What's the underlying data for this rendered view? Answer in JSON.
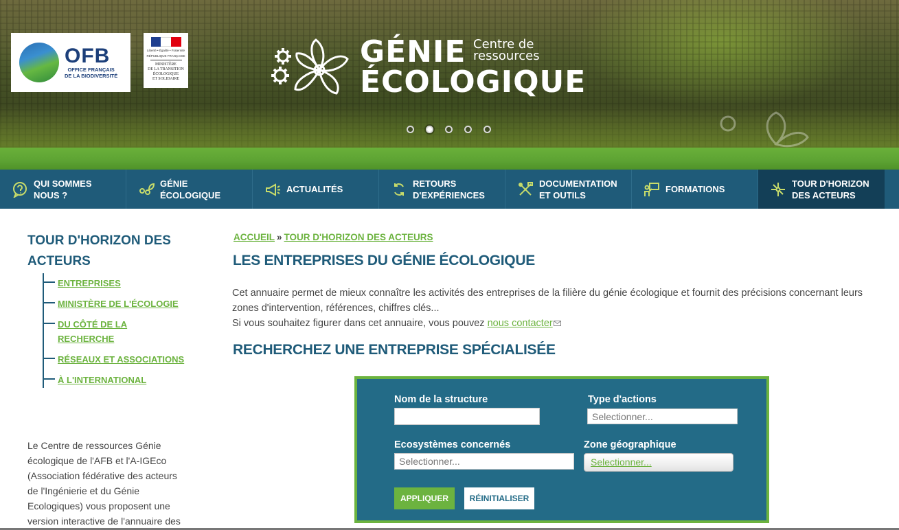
{
  "hero": {
    "title_main": "GÉNIE",
    "title_tag": "Centre de ressources",
    "title_second": "ÉCOLOGIQUE",
    "ofb_logo": {
      "acronym": "OFB",
      "subtitle_line1": "OFFICE FRANÇAIS",
      "subtitle_line2": "DE LA BIODIVERSITÉ"
    },
    "ministry_logo": {
      "motto": "Liberté • Égalité • Fraternité",
      "republic": "RÉPUBLIQUE FRANÇAISE",
      "name_line1": "MINISTÈRE",
      "name_line2": "DE LA TRANSITION",
      "name_line3": "ÉCOLOGIQUE",
      "name_line4": "ET SOLIDAIRE"
    },
    "carousel": {
      "slides": 5,
      "active_index": 1
    }
  },
  "nav": {
    "items": [
      {
        "label": "QUI SOMMES\nNOUS ?",
        "icon": "question-bubble-icon"
      },
      {
        "label": "GÉNIE\nÉCOLOGIQUE",
        "icon": "gears-leaf-icon"
      },
      {
        "label": "ACTUALITÉS",
        "icon": "megaphone-icon"
      },
      {
        "label": "RETOURS\nD'EXPÉRIENCES",
        "icon": "refresh-arrows-icon"
      },
      {
        "label": "DOCUMENTATION\nET OUTILS",
        "icon": "tools-icon"
      },
      {
        "label": "FORMATIONS",
        "icon": "presentation-icon"
      },
      {
        "label": "TOUR D'HORIZON\nDES ACTEURS",
        "icon": "network-icon"
      }
    ],
    "active_index": 6
  },
  "sidebar": {
    "title": "TOUR D'HORIZON DES ACTEURS",
    "items": [
      {
        "label": "ENTREPRISES"
      },
      {
        "label": "MINISTÈRE DE L'ÉCOLOGIE"
      },
      {
        "label": "DU CÔTÉ DE LA RECHERCHE"
      },
      {
        "label": "RÉSEAUX ET ASSOCIATIONS"
      },
      {
        "label": "À L'INTERNATIONAL"
      }
    ],
    "note": "Le Centre de ressources Génie écologique de l'AFB et l'A-IGEco (Association fédérative des acteurs de l'Ingénierie et du Génie Ecologiques) vous proposent une version interactive de l'annuaire des"
  },
  "breadcrumb": {
    "home": "ACCUEIL",
    "separator": "»",
    "current": "TOUR D'HORIZON DES ACTEURS"
  },
  "main": {
    "title": "LES ENTREPRISES DU GÉNIE ÉCOLOGIQUE",
    "intro_line1": "Cet annuaire permet de mieux connaître les activités des entreprises de la filière du génie écologique et fournit des précisions concernant leurs zones d'intervention, références, chiffres clés...",
    "intro_line2_prefix": "Si vous souhaitez figurer dans cet annuaire, vous pouvez ",
    "contact_link": "nous contacter",
    "search_title": "RECHERCHEZ UNE ENTREPRISE SPÉCIALISÉE"
  },
  "filter": {
    "name_label": "Nom de la structure",
    "name_value": "",
    "type_label": "Type d'actions",
    "type_placeholder": "Selectionner...",
    "eco_label": "Ecosystèmes concernés",
    "eco_placeholder": "Selectionner...",
    "zone_label": "Zone géographique",
    "zone_value": "Selectionner...",
    "apply_label": "APPLIQUER",
    "reset_label": "RÉINITIALISER"
  },
  "colors": {
    "primary_blue": "#1f5b79",
    "accent_green": "#6cb33f",
    "nav_active": "#133f57",
    "filter_bg": "#236b87"
  }
}
